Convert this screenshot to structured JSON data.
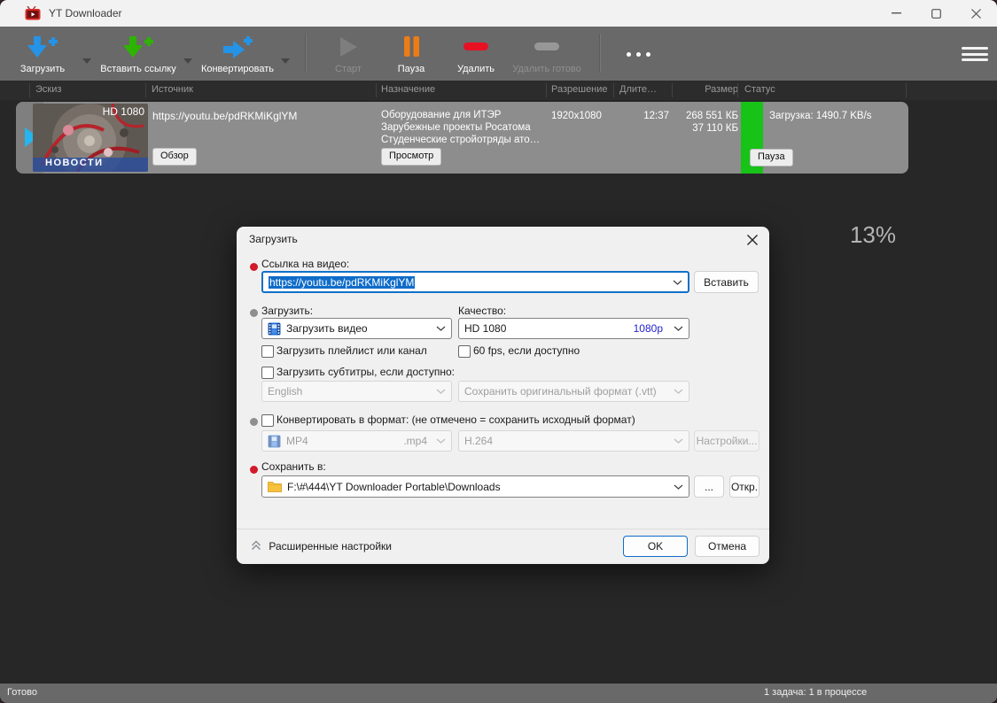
{
  "window": {
    "title": "YT Downloader"
  },
  "toolbar": {
    "buttons": [
      {
        "label": "Загрузить"
      },
      {
        "label": "Вставить ссылку"
      },
      {
        "label": "Конвертировать"
      },
      {
        "label": "Старт",
        "disabled": true
      },
      {
        "label": "Пауза"
      },
      {
        "label": "Удалить"
      },
      {
        "label": "Удалить готово",
        "disabled": true
      }
    ]
  },
  "table": {
    "columns": [
      "Эскиз",
      "Источник",
      "Назначение",
      "Разрешение",
      "Длите…",
      "Размер",
      "Статус"
    ]
  },
  "row": {
    "thumb_badge": "HD 1080",
    "thumb_caption": "НОВОСТИ",
    "source_url": "https://youtu.be/pdRKMiKglYM",
    "source_button": "Обзор",
    "dest_line1": "Оборудование для ИТЭР",
    "dest_line2": "Зарубежные проекты Росатома",
    "dest_line3": "Студенческие стройотряды ато…",
    "dest_button": "Просмотр",
    "resolution": "1920x1080",
    "duration": "12:37",
    "size_total": "268 551 КБ",
    "size_done": "37 110 КБ",
    "status_speed": "Загрузка: 1490.7 KB/s",
    "status_percent": "13%",
    "progress_percent": 13,
    "status_button": "Пауза"
  },
  "dialog": {
    "title": "Загрузить",
    "url_label": "Ссылка на видео:",
    "url_value": "https://youtu.be/pdRKMiKglYM",
    "paste_button": "Вставить",
    "download_label": "Загрузить:",
    "download_value": "Загрузить видео",
    "quality_label": "Качество:",
    "quality_value": "HD 1080",
    "quality_tag": "1080p",
    "playlist_checkbox": "Загрузить плейлист или канал",
    "fps_checkbox": "60 fps, если доступно",
    "subtitles_checkbox": "Загрузить субтитры, если доступно:",
    "subtitles_lang": "English",
    "subtitles_format": "Сохранить оригинальный формат (.vtt)",
    "convert_checkbox": "Конвертировать в формат: (не отмечено = сохранить исходный формат)",
    "convert_format": "MP4",
    "convert_ext": ".mp4",
    "convert_codec": "H.264",
    "settings_button": "Настройки...",
    "save_label": "Сохранить в:",
    "save_path": "F:\\#\\444\\YT Downloader Portable\\Downloads",
    "browse_button": "...",
    "open_button": "Откр.",
    "advanced_label": "Расширенные настройки",
    "ok_button": "OK",
    "cancel_button": "Отмена"
  },
  "statusbar": {
    "left": "Готово",
    "right": "1 задача: 1 в процессе"
  },
  "colors": {
    "accent_blue": "#2493e8",
    "paste_green": "#2db300",
    "pause_orange": "#ee7c15",
    "delete_red": "#e81123",
    "progress_green": "#17c317",
    "selection_blue": "#0f6cc9",
    "quality_link_blue": "#2222cc"
  }
}
